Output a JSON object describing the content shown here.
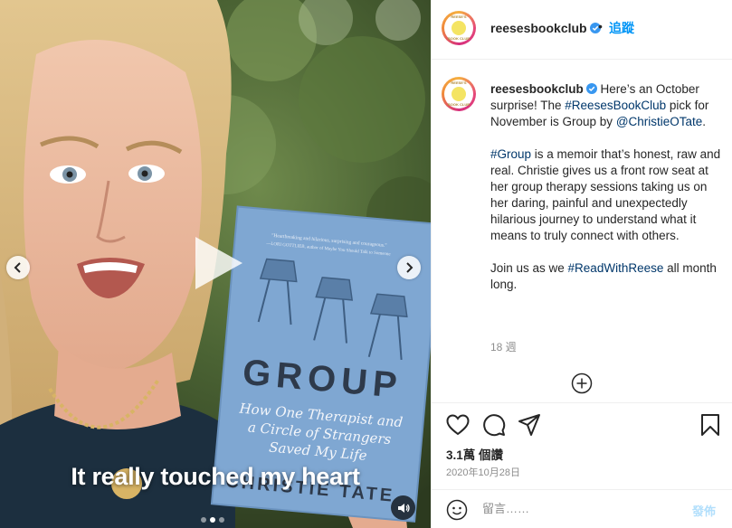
{
  "media": {
    "caption": "It really touched my heart",
    "book": {
      "blurb_line1": "\"Heartbreaking and hilarious, surprising and courageous.\"",
      "blurb_line2": "—LORI GOTTLIEB, author of Maybe You Should Talk to Someone",
      "title": "GROUP",
      "subtitle_line1": "How One Therapist and",
      "subtitle_line2": "a Circle of Strangers",
      "subtitle_line3": "Saved My Life",
      "author": "CHRISTIE TATE"
    },
    "carousel": {
      "total": 3,
      "active": 1
    }
  },
  "header": {
    "username": "reesesbookclub",
    "separator": "•",
    "follow_label": "追蹤",
    "avatar_text_top": "REESE'S",
    "avatar_text_bottom": "BOOK CLUB"
  },
  "caption": {
    "username": "reesesbookclub",
    "p1_a": " Here’s an October surprise! The ",
    "p1_tag1": "#ReesesBookClub",
    "p1_b": " pick for November is Group by ",
    "p1_mention": "@ChristieOTate",
    "p1_c": ".",
    "p2_tag": "#Group",
    "p2_text": " is a memoir that’s honest, raw and real. Christie gives us a front row seat at her group therapy sessions taking us on her daring, painful and unexpectedly hilarious journey to understand what it means to truly connect with others.",
    "p3_a": "Join us as we ",
    "p3_tag": "#ReadWithReese",
    "p3_b": " all month long.",
    "time": "18 週"
  },
  "stats": {
    "views": "3.1萬 個讚",
    "date": "2020年10月28日"
  },
  "comment_box": {
    "placeholder": "留言……",
    "post_label": "發佈"
  },
  "colors": {
    "accent": "#0095f6",
    "link": "#00376b",
    "book_cover": "#7fa7d2",
    "post_disabled": "#b2dffc"
  },
  "icons": [
    "play-icon",
    "chevron-left-icon",
    "chevron-right-icon",
    "sound-icon",
    "verified-icon",
    "add-circle-icon",
    "heart-icon",
    "comment-icon",
    "share-icon",
    "bookmark-icon",
    "emoji-icon"
  ]
}
